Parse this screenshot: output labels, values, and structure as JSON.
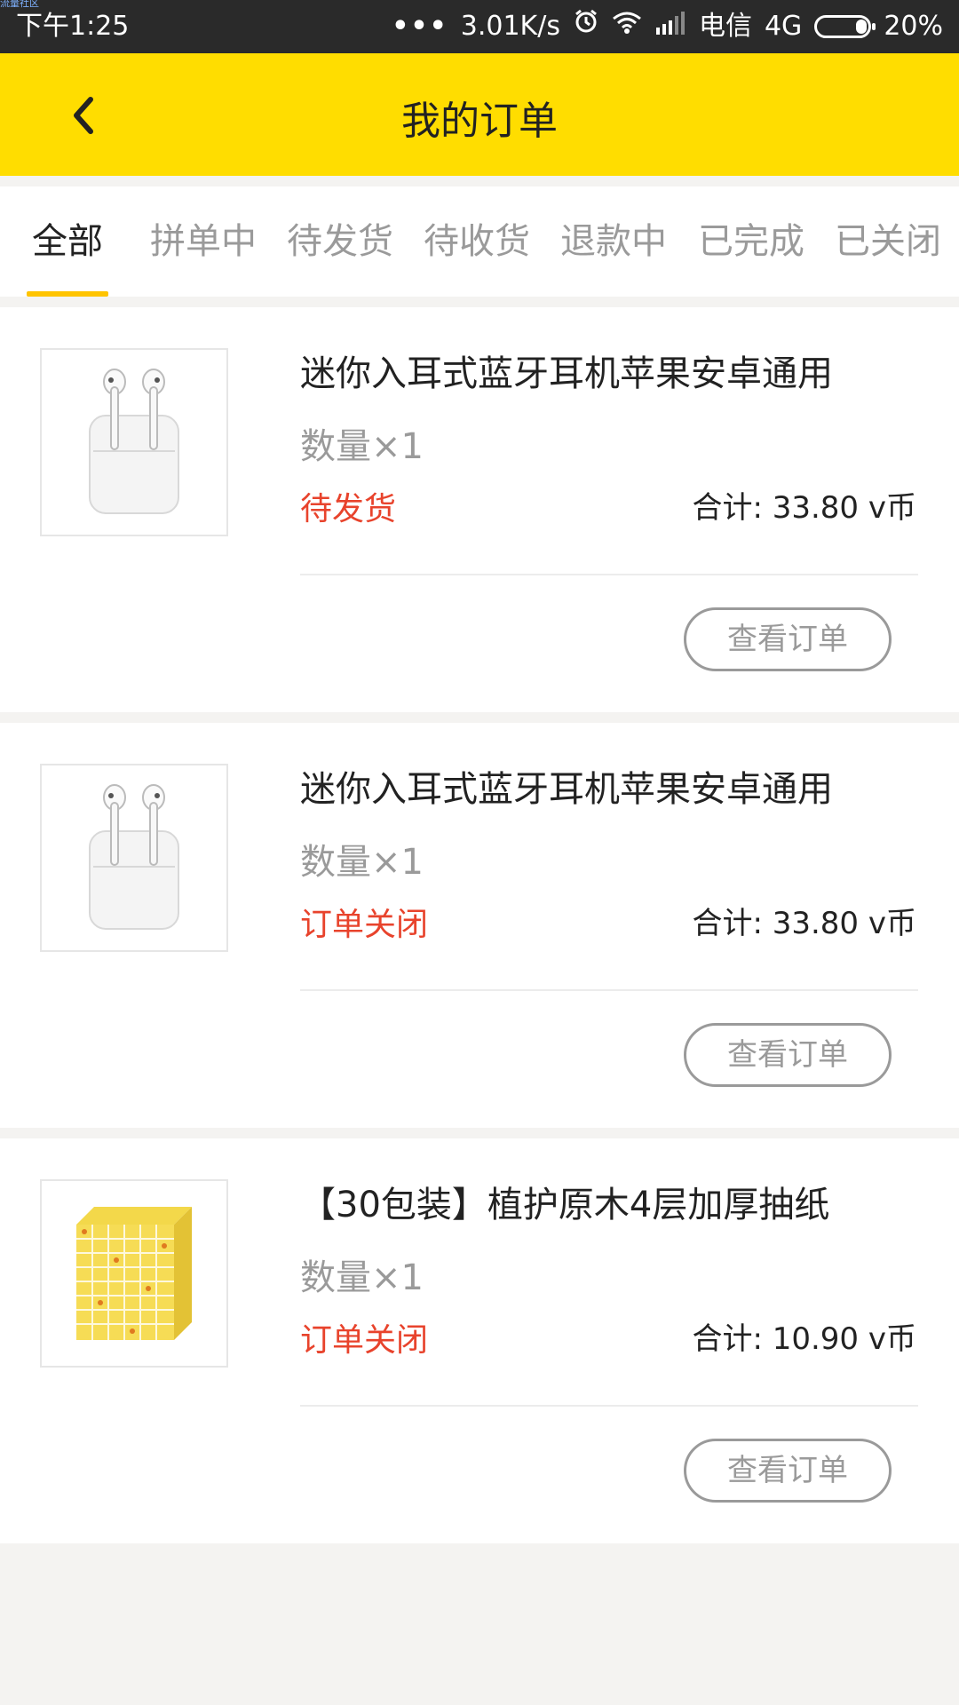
{
  "status_bar": {
    "watermark": "流量社区",
    "time": "下午1:25",
    "dots": "•••",
    "speed": "3.01K/s",
    "carrier": "电信",
    "network": "4G",
    "battery": "20%"
  },
  "header": {
    "title": "我的订单"
  },
  "tabs": [
    {
      "label": "全部",
      "active": true
    },
    {
      "label": "拼单中"
    },
    {
      "label": "待发货"
    },
    {
      "label": "待收货"
    },
    {
      "label": "退款中"
    },
    {
      "label": "已完成"
    },
    {
      "label": "已关闭"
    }
  ],
  "orders": [
    {
      "name": "迷你入耳式蓝牙耳机苹果安卓通用",
      "quantity": "数量×1",
      "status": "待发货",
      "total": "合计: 33.80 v币",
      "button": "查看订单",
      "image": "earbuds-image"
    },
    {
      "name": "迷你入耳式蓝牙耳机苹果安卓通用",
      "quantity": "数量×1",
      "status": "订单关闭",
      "total": "合计: 33.80 v币",
      "button": "查看订单",
      "image": "earbuds-image"
    },
    {
      "name": "【30包装】植护原木4层加厚抽纸",
      "quantity": "数量×1",
      "status": "订单关闭",
      "total": "合计: 10.90 v币",
      "button": "查看订单",
      "image": "tissue-boxes-image"
    }
  ],
  "colors": {
    "header_bg": "#ffdd00",
    "tab_indicator": "#ffc400",
    "status_red": "#e8432c"
  }
}
